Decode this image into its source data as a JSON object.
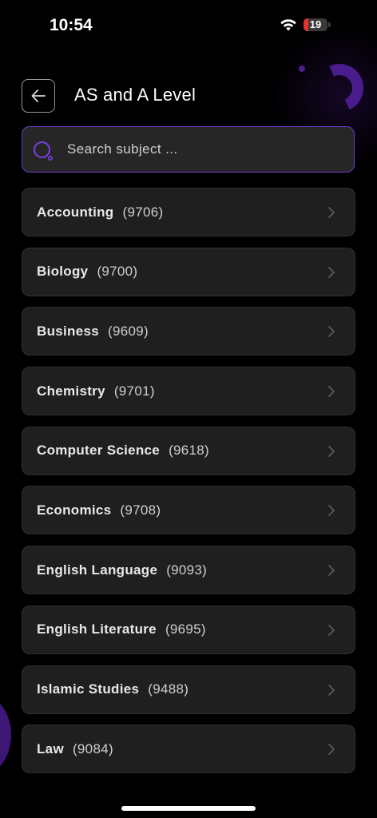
{
  "status_bar": {
    "time": "10:54",
    "battery_level": "19",
    "battery_fraction": 0.19,
    "battery_color": "#e5342f"
  },
  "header": {
    "title": "AS and A Level",
    "back_icon": "arrow-left-icon"
  },
  "search": {
    "placeholder": "Search subject ...",
    "value": "",
    "icon": "search-icon",
    "accent_color": "#6a3bc8"
  },
  "subjects": [
    {
      "name": "Accounting",
      "code": "(9706)"
    },
    {
      "name": "Biology",
      "code": "(9700)"
    },
    {
      "name": "Business",
      "code": "(9609)"
    },
    {
      "name": "Chemistry",
      "code": "(9701)"
    },
    {
      "name": "Computer Science",
      "code": "(9618)"
    },
    {
      "name": "Economics",
      "code": "(9708)"
    },
    {
      "name": "English Language",
      "code": "(9093)"
    },
    {
      "name": "English Literature",
      "code": "(9695)"
    },
    {
      "name": "Islamic Studies",
      "code": "(9488)"
    },
    {
      "name": "Law",
      "code": "(9084)"
    }
  ],
  "colors": {
    "background": "#000000",
    "card": "#1f1f1f",
    "accent": "#6a3bc8"
  }
}
